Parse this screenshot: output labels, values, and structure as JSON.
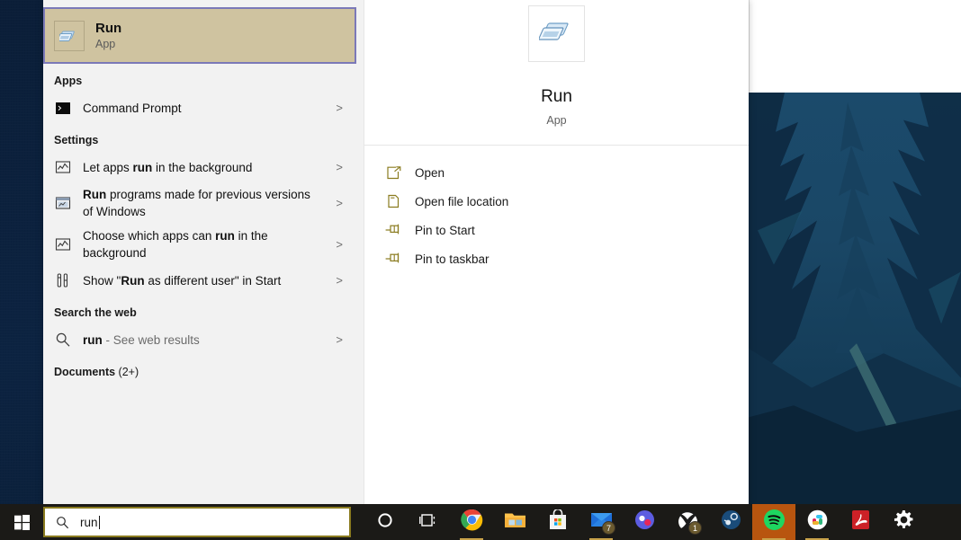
{
  "taskbar": {
    "start_label": "Start",
    "search": {
      "value": "run",
      "icon": "search-icon"
    },
    "items": [
      {
        "name": "cortana",
        "label": "Cortana",
        "badge": null,
        "active": false,
        "underline": false
      },
      {
        "name": "task-view",
        "label": "Task View",
        "badge": null,
        "active": false,
        "underline": false
      },
      {
        "name": "google-chrome",
        "label": "Google Chrome",
        "badge": null,
        "active": false,
        "underline": true
      },
      {
        "name": "file-explorer",
        "label": "File Explorer",
        "badge": null,
        "active": false,
        "underline": false
      },
      {
        "name": "microsoft-store",
        "label": "Microsoft Store",
        "badge": null,
        "active": false,
        "underline": false
      },
      {
        "name": "mail",
        "label": "Mail",
        "badge": "7",
        "active": false,
        "underline": true
      },
      {
        "name": "discord",
        "label": "Discord",
        "badge": null,
        "active": false,
        "underline": false
      },
      {
        "name": "xbox",
        "label": "Xbox",
        "badge": "1",
        "active": false,
        "underline": false
      },
      {
        "name": "steam",
        "label": "Steam",
        "badge": null,
        "active": false,
        "underline": false
      },
      {
        "name": "spotify",
        "label": "Spotify",
        "badge": null,
        "active": true,
        "underline": true
      },
      {
        "name": "slack",
        "label": "Slack",
        "badge": null,
        "active": false,
        "underline": true
      },
      {
        "name": "adobe-acrobat",
        "label": "Adobe Acrobat",
        "badge": null,
        "active": false,
        "underline": false
      },
      {
        "name": "settings",
        "label": "Settings",
        "badge": null,
        "active": false,
        "underline": false
      }
    ]
  },
  "search_panel": {
    "best_match": {
      "title": "Run",
      "subtitle": "App",
      "icon": "run-app-icon",
      "highlight_fill": "#cfc3a0",
      "highlight_border": "#7b79b8"
    },
    "groups": [
      {
        "header": "Apps",
        "header_suffix": "",
        "items": [
          {
            "icon": "command-prompt-icon",
            "parts": [
              {
                "t": "Command Prompt",
                "b": false
              }
            ],
            "chevron": ">"
          }
        ]
      },
      {
        "header": "Settings",
        "header_suffix": "",
        "items": [
          {
            "icon": "background-apps-icon",
            "parts": [
              {
                "t": "Let apps ",
                "b": false
              },
              {
                "t": "run",
                "b": true
              },
              {
                "t": " in the background",
                "b": false
              }
            ],
            "chevron": ">"
          },
          {
            "icon": "compatibility-icon",
            "parts": [
              {
                "t": "Run",
                "b": true
              },
              {
                "t": " programs made for previous versions of Windows",
                "b": false
              }
            ],
            "chevron": ">"
          },
          {
            "icon": "background-apps-icon",
            "parts": [
              {
                "t": "Choose which apps can ",
                "b": false
              },
              {
                "t": "run",
                "b": true
              },
              {
                "t": " in the background",
                "b": false
              }
            ],
            "chevron": ">"
          },
          {
            "icon": "start-settings-icon",
            "parts": [
              {
                "t": "Show \"",
                "b": false
              },
              {
                "t": "Run",
                "b": true
              },
              {
                "t": " as different user\" in Start",
                "b": false
              }
            ],
            "chevron": ">"
          }
        ]
      },
      {
        "header": "Search the web",
        "header_suffix": "",
        "items": [
          {
            "icon": "search-icon",
            "parts": [
              {
                "t": "run",
                "b": true
              },
              {
                "t": " - See web results",
                "b": false,
                "muted": true
              }
            ],
            "chevron": ">"
          }
        ]
      },
      {
        "header": "Documents",
        "header_suffix": " (2+)",
        "items": []
      }
    ]
  },
  "preview": {
    "icon": "run-app-icon",
    "title": "Run",
    "subtitle": "App",
    "actions": [
      {
        "icon": "open-icon",
        "label": "Open"
      },
      {
        "icon": "folder-icon",
        "label": "Open file location"
      },
      {
        "icon": "pin-icon",
        "label": "Pin to Start"
      },
      {
        "icon": "pin-icon",
        "label": "Pin to taskbar"
      }
    ]
  },
  "colors": {
    "panel_bg": "#f2f2f2",
    "preview_bg": "#ffffff",
    "taskbar_bg": "#1b1a17",
    "accent_border": "#8a7b1f",
    "selection_border": "#7b79b8",
    "wallpaper_base": "#0c2039"
  }
}
